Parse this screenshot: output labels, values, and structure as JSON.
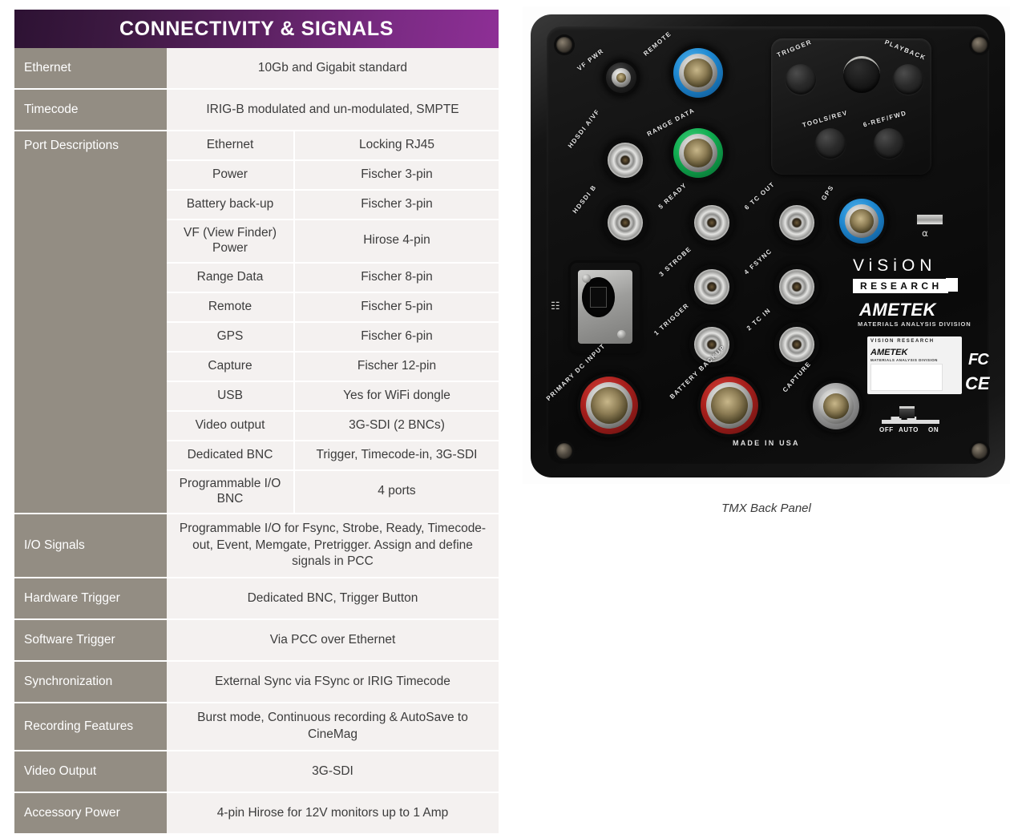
{
  "spec_table": {
    "header": "CONNECTIVITY & SIGNALS",
    "header_gradient_from": "#2d1233",
    "header_gradient_to": "#8e2f96",
    "key_cell_color": "#938d83",
    "value_cell_color": "#f4f1f0",
    "rows": [
      {
        "key": "Ethernet",
        "value": "10Gb and Gigabit standard"
      },
      {
        "key": "Timecode",
        "value": "IRIG-B modulated and un-modulated, SMPTE"
      }
    ],
    "port_descriptions": {
      "key": "Port Descriptions",
      "items": [
        {
          "name": "Ethernet",
          "spec": "Locking RJ45"
        },
        {
          "name": "Power",
          "spec": "Fischer 3-pin"
        },
        {
          "name": "Battery back-up",
          "spec": "Fischer 3-pin"
        },
        {
          "name": "VF (View Finder) Power",
          "spec": "Hirose 4-pin"
        },
        {
          "name": "Range Data",
          "spec": "Fischer 8-pin"
        },
        {
          "name": "Remote",
          "spec": "Fischer 5-pin"
        },
        {
          "name": "GPS",
          "spec": "Fischer 6-pin"
        },
        {
          "name": "Capture",
          "spec": "Fischer 12-pin"
        },
        {
          "name": "USB",
          "spec": "Yes for WiFi dongle"
        },
        {
          "name": "Video output",
          "spec": "3G-SDI (2 BNCs)"
        },
        {
          "name": "Dedicated BNC",
          "spec": "Trigger, Timecode-in, 3G-SDI"
        },
        {
          "name": "Programmable I/O BNC",
          "spec": "4  ports"
        }
      ]
    },
    "rows_after": [
      {
        "key": "I/O Signals",
        "value": "Programmable I/O for Fsync, Strobe, Ready, Timecode-out, Event, Memgate, Pretrigger. Assign and define signals in PCC"
      },
      {
        "key": "Hardware Trigger",
        "value": "Dedicated BNC, Trigger Button"
      },
      {
        "key": "Software Trigger",
        "value": "Via PCC over Ethernet"
      },
      {
        "key": "Synchronization",
        "value": "External Sync via FSync or IRIG Timecode"
      },
      {
        "key": "Recording Features",
        "value": "Burst mode, Continuous recording & AutoSave to CineMag"
      },
      {
        "key": "Video Output",
        "value": "3G-SDI"
      },
      {
        "key": "Accessory Power",
        "value": "4-pin Hirose for 12V monitors up to 1 Amp"
      }
    ]
  },
  "product_image": {
    "caption": "TMX Back Panel",
    "connector_labels": {
      "vf_pwr": "VF PWR",
      "remote": "REMOTE",
      "hdsdi_a_vf": "HDSDI A/VF",
      "range_data": "RANGE DATA",
      "hdsdi_b": "HDSDI B",
      "ready": "5 READY",
      "tc_out": "6 TC OUT",
      "gps": "GPS",
      "strobe": "3 STROBE",
      "fsync": "4 FSYNC",
      "trigger_bnc": "1 TRIGGER",
      "tc_in": "2 TC IN",
      "primary_dc": "PRIMARY DC INPUT",
      "battery_backup": "BATTERY BACKUP",
      "capture": "CAPTURE"
    },
    "buttons": {
      "trigger": "TRIGGER",
      "playback": "PLAYBACK",
      "tools_rev": "TOOLS/REV",
      "ref_fwd": "6-REF/FWD"
    },
    "branding": {
      "vision": "ViSiON",
      "research": "RESEARCH",
      "ametek": "AMETEK",
      "division": "MATERIALS ANALYSIS DIVISION",
      "plate_vision": "VISION RESEARCH",
      "plate_ametek": "AMETEK",
      "plate_division": "MATERIALS ANALYSIS DIVISION",
      "fcc": "FC",
      "ce": "CE"
    },
    "power_switch": {
      "off": "OFF",
      "auto": "AUTO",
      "on": "ON"
    },
    "origin": "MADE IN USA"
  }
}
